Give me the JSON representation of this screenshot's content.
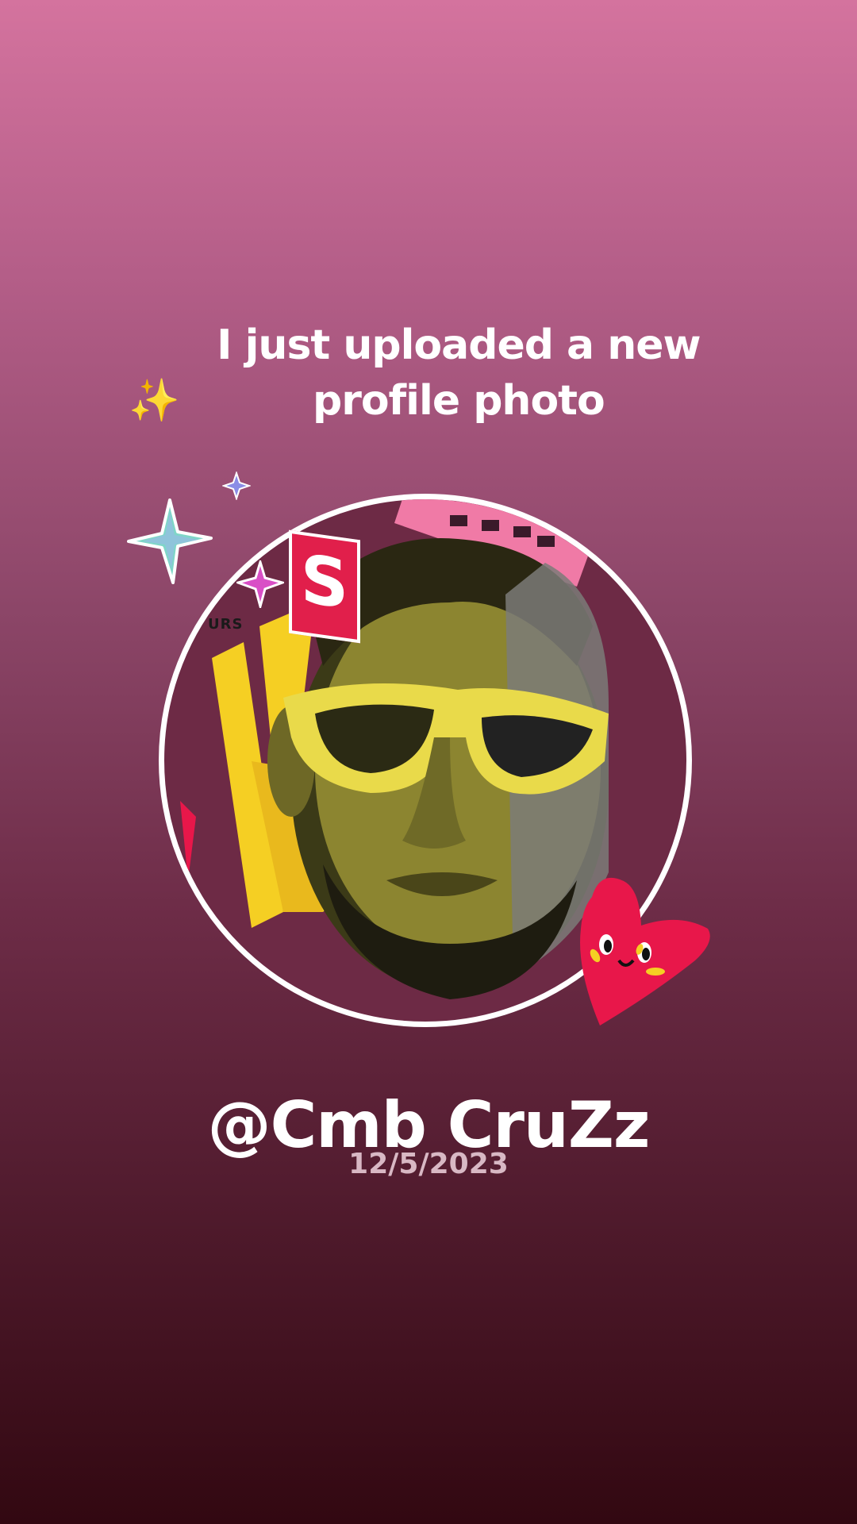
{
  "headline": {
    "sparkle_icon": "sparkles-icon",
    "sparkle_glyph": "✨",
    "text": "I just uploaded a new profile photo"
  },
  "profile": {
    "username": "@Cmb CruZz",
    "date": "12/5/2023"
  },
  "stickers": {
    "logo_text_fragment": "URS",
    "logo_letter": "S"
  },
  "colors": {
    "background_top": "#d4739e",
    "background_bottom": "#320811",
    "ring": "#ffffff",
    "accent_yellow": "#f5cf23",
    "heart": "#e8174a",
    "keyboard_pink": "#f07aa6"
  }
}
